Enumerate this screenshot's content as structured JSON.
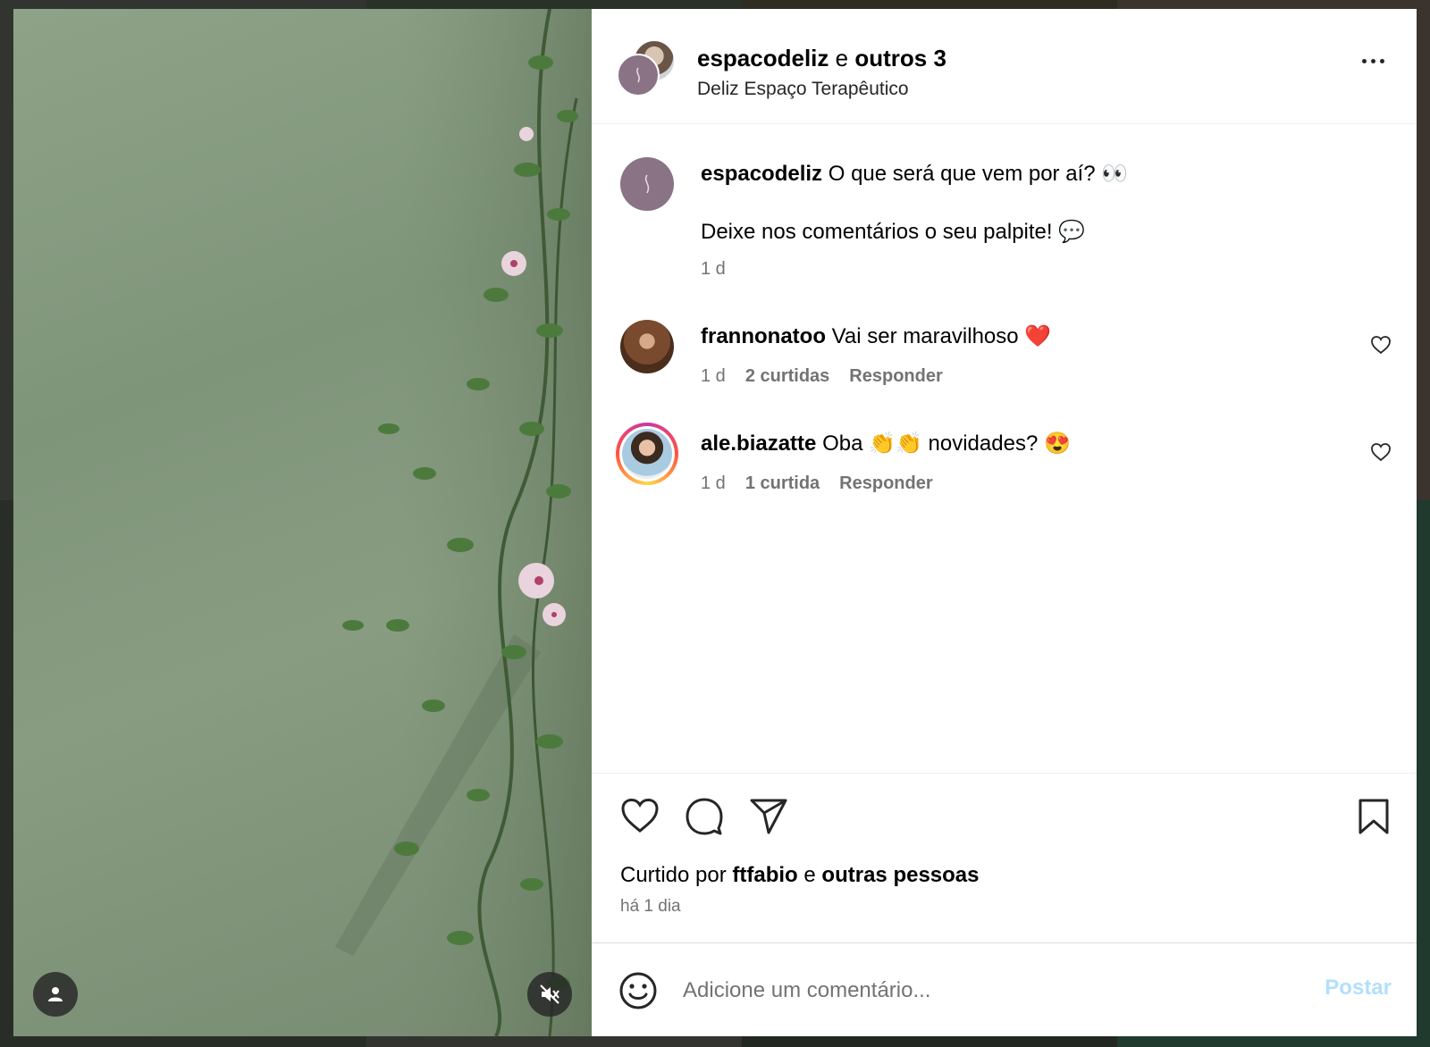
{
  "header": {
    "author": "espacodeliz",
    "joiner": "e",
    "others": "outros 3",
    "location": "Deliz Espaço Terapêutico"
  },
  "caption": {
    "username": "espacodeliz",
    "line1": "O que será que vem por aí? 👀",
    "line2": "Deixe nos comentários o seu palpite! 💬",
    "time": "1 d"
  },
  "comments": [
    {
      "username": "frannonatoo",
      "text": "Vai ser maravilhoso ❤️",
      "time": "1 d",
      "likes": "2 curtidas",
      "reply": "Responder"
    },
    {
      "username": "ale.biazatte",
      "text": "Oba 👏👏 novidades? 😍",
      "time": "1 d",
      "likes": "1 curtida",
      "reply": "Responder"
    }
  ],
  "likes": {
    "prefix": "Curtido por",
    "user": "ftfabio",
    "joiner": "e",
    "others": "outras pessoas"
  },
  "post_time": "há 1 dia",
  "add_comment": {
    "placeholder": "Adicione um comentário...",
    "post_label": "Postar"
  },
  "colors": {
    "post_button": "#b2dffc",
    "meta_text": "#737373"
  },
  "icons": {
    "like": "heart-icon",
    "comment": "comment-icon",
    "share": "share-icon",
    "save": "bookmark-icon",
    "emoji": "emoji-icon",
    "tags": "user-tag-icon",
    "audio": "muted-speaker-icon",
    "more": "more-options-icon"
  }
}
